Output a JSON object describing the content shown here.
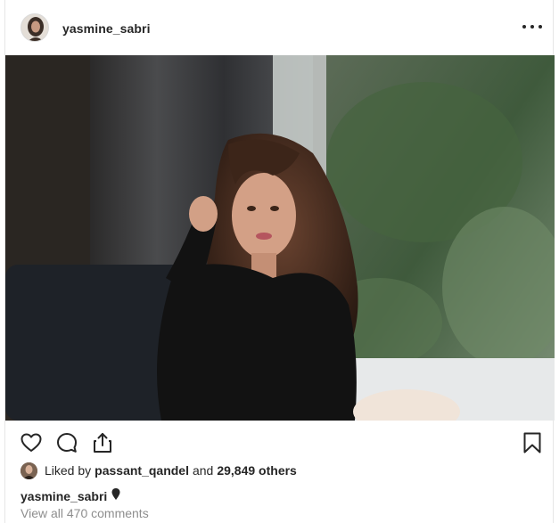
{
  "post": {
    "username": "yasmine_sabri",
    "more_label": "More options"
  },
  "actions": {
    "like": "heart-icon",
    "comment": "comment-icon",
    "share": "share-icon",
    "save": "bookmark-icon"
  },
  "likes": {
    "prefix": "Liked by",
    "liker": "passant_qandel",
    "conjunction": "and",
    "others": "29,849 others"
  },
  "caption": {
    "username": "yasmine_sabri",
    "emoji_icon": "pin-icon"
  },
  "comments": {
    "view_all": "View all 470 comments"
  },
  "colors": {
    "text": "#262626",
    "muted": "#8e8e8e",
    "border": "#e6e6e6"
  }
}
